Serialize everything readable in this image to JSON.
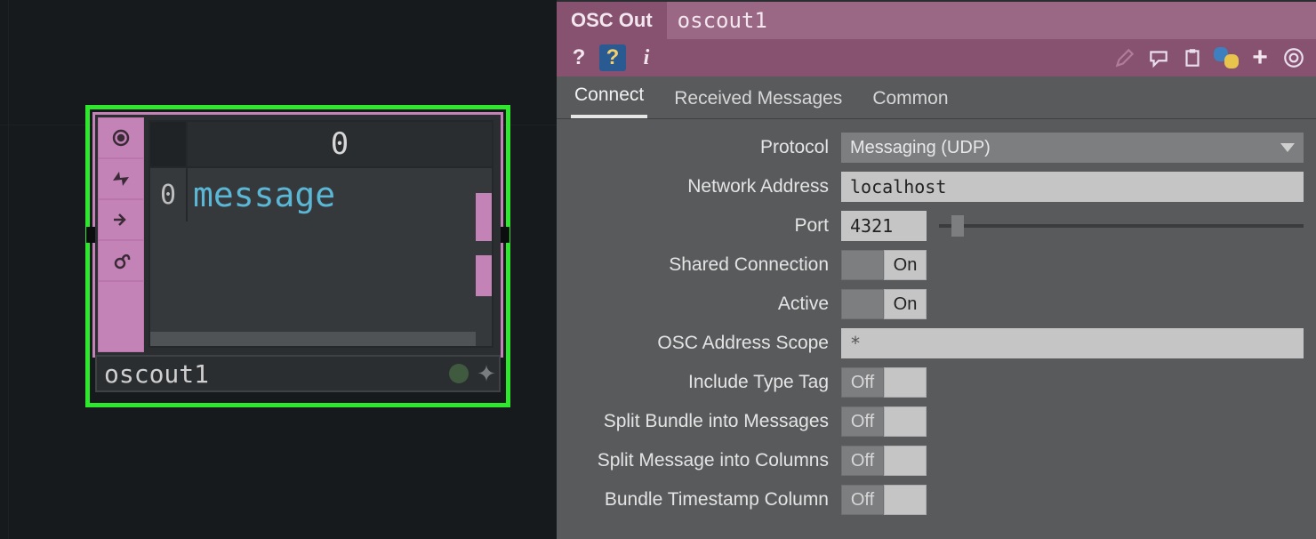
{
  "node": {
    "name": "oscout1",
    "table": {
      "col_header": "0",
      "row_index": "0",
      "row_value": "message"
    }
  },
  "panel": {
    "header": {
      "type_label": "OSC Out",
      "name_value": "oscout1"
    },
    "tabs": [
      {
        "id": "connect",
        "label": "Connect",
        "active": true
      },
      {
        "id": "received",
        "label": "Received Messages",
        "active": false
      },
      {
        "id": "common",
        "label": "Common",
        "active": false
      }
    ],
    "params": {
      "protocol": {
        "label": "Protocol",
        "value": "Messaging (UDP)"
      },
      "netaddress": {
        "label": "Network Address",
        "value": "localhost"
      },
      "port": {
        "label": "Port",
        "value": "4321",
        "slider_pos_pct": 5
      },
      "shared": {
        "label": "Shared Connection",
        "value": "On"
      },
      "active": {
        "label": "Active",
        "value": "On"
      },
      "scope": {
        "label": "OSC Address Scope",
        "value": "*"
      },
      "typetag": {
        "label": "Include Type Tag",
        "value": "Off"
      },
      "splitbundle": {
        "label": "Split Bundle into Messages",
        "value": "Off"
      },
      "splitmsg": {
        "label": "Split Message into Columns",
        "value": "Off"
      },
      "bundlets": {
        "label": "Bundle Timestamp Column",
        "value": "Off"
      }
    },
    "toggle_labels": {
      "off": "Off",
      "on": "On"
    }
  }
}
